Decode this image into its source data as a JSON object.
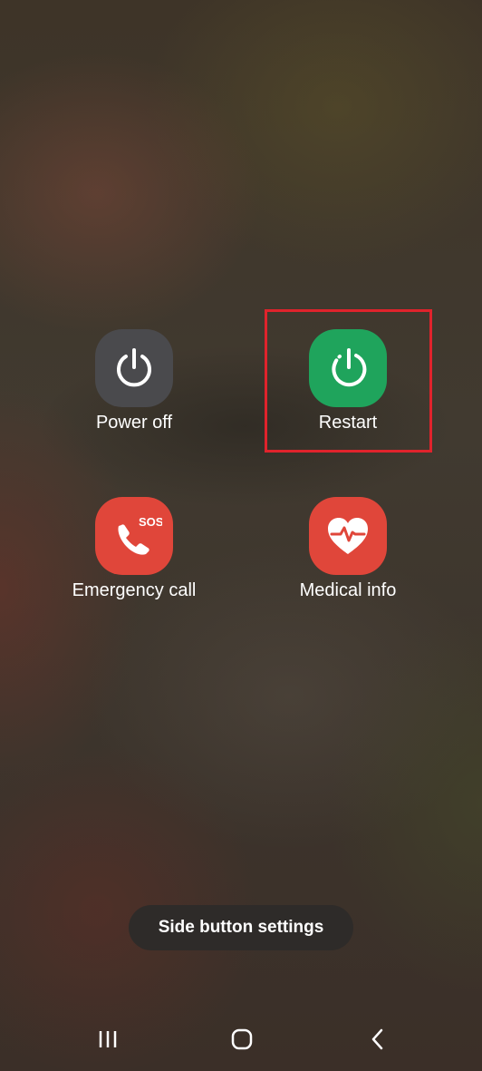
{
  "power_menu": {
    "options": [
      {
        "label": "Power off",
        "icon": "power-icon",
        "color": "#4a4a4d"
      },
      {
        "label": "Restart",
        "icon": "restart-icon",
        "color": "#1fa45c"
      },
      {
        "label": "Emergency call",
        "icon": "sos-phone-icon",
        "color": "#e0463a",
        "badge": "SOS"
      },
      {
        "label": "Medical info",
        "icon": "heart-pulse-icon",
        "color": "#e0463a"
      }
    ],
    "highlight_color": "#e0232c"
  },
  "side_button_settings": {
    "label": "Side button settings"
  },
  "navigation_bar": {
    "recents": "recents-icon",
    "home": "home-icon",
    "back": "back-icon"
  }
}
